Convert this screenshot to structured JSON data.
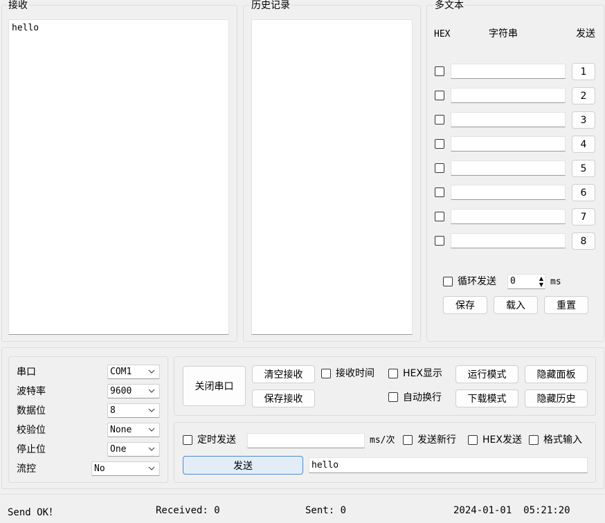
{
  "receive": {
    "title": "接收",
    "text": "hello"
  },
  "history": {
    "title": "历史记录"
  },
  "multitext": {
    "title": "多文本",
    "col_hex": "HEX",
    "col_string": "字符串",
    "col_send": "发送",
    "rows": [
      "1",
      "2",
      "3",
      "4",
      "5",
      "6",
      "7",
      "8"
    ],
    "loop_label": "循环发送",
    "loop_value": "0",
    "loop_unit": "ms",
    "save_label": "保存",
    "load_label": "载入",
    "reset_label": "重置"
  },
  "port": {
    "port_label": "串口",
    "port_value": "COM1",
    "baud_label": "波特率",
    "baud_value": "9600",
    "databits_label": "数据位",
    "databits_value": "8",
    "parity_label": "校验位",
    "parity_value": "None",
    "stopbits_label": "停止位",
    "stopbits_value": "One",
    "flow_label": "流控",
    "flow_value": "No"
  },
  "controls": {
    "close_port": "关闭串口",
    "clear_receive": "清空接收",
    "save_receive": "保存接收",
    "receive_time": "接收时间",
    "hex_display": "HEX显示",
    "auto_wrap": "自动换行",
    "run_mode": "运行模式",
    "download_mode": "下载模式",
    "hide_panel": "隐藏面板",
    "hide_history": "隐藏历史"
  },
  "send": {
    "timed_send": "定时发送",
    "timed_value": "",
    "timed_unit": "ms/次",
    "send_newline": "发送新行",
    "hex_send": "HEX发送",
    "format_input": "格式输入",
    "send_button": "发送",
    "send_text": "hello"
  },
  "status": {
    "message": "Send OK！",
    "received": "Received: 0",
    "sent": "Sent: 0",
    "time": "2024-01-01  05:21:20"
  }
}
